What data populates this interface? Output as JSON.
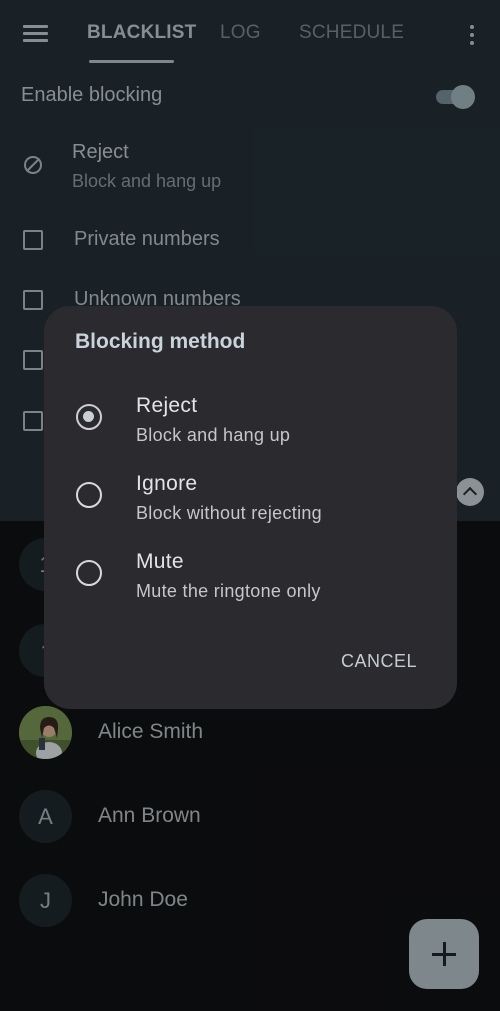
{
  "tabs": {
    "active": "BLACKLIST",
    "log": "LOG",
    "schedule": "SCHEDULE"
  },
  "settings": {
    "enable_label": "Enable blocking",
    "enable_on": true,
    "reject_title": "Reject",
    "reject_sub": "Block and hang up",
    "checkboxes": [
      "Private numbers",
      "Unknown numbers",
      "",
      ""
    ]
  },
  "contacts": [
    {
      "initial": "1",
      "name": ""
    },
    {
      "initial": "?",
      "name": ""
    },
    {
      "initial": "",
      "name": "Alice Smith"
    },
    {
      "initial": "A",
      "name": "Ann Brown"
    },
    {
      "initial": "J",
      "name": "John Doe"
    }
  ],
  "dialog": {
    "title": "Blocking method",
    "options": [
      {
        "title": "Reject",
        "sub": "Block and hang up",
        "selected": true
      },
      {
        "title": "Ignore",
        "sub": "Block without rejecting",
        "selected": false
      },
      {
        "title": "Mute",
        "sub": "Mute the ringtone only",
        "selected": false
      }
    ],
    "cancel": "CANCEL"
  },
  "icons": [
    "menu-icon",
    "more-vert-icon",
    "block-icon",
    "chevron-up-icon",
    "plus-icon"
  ]
}
